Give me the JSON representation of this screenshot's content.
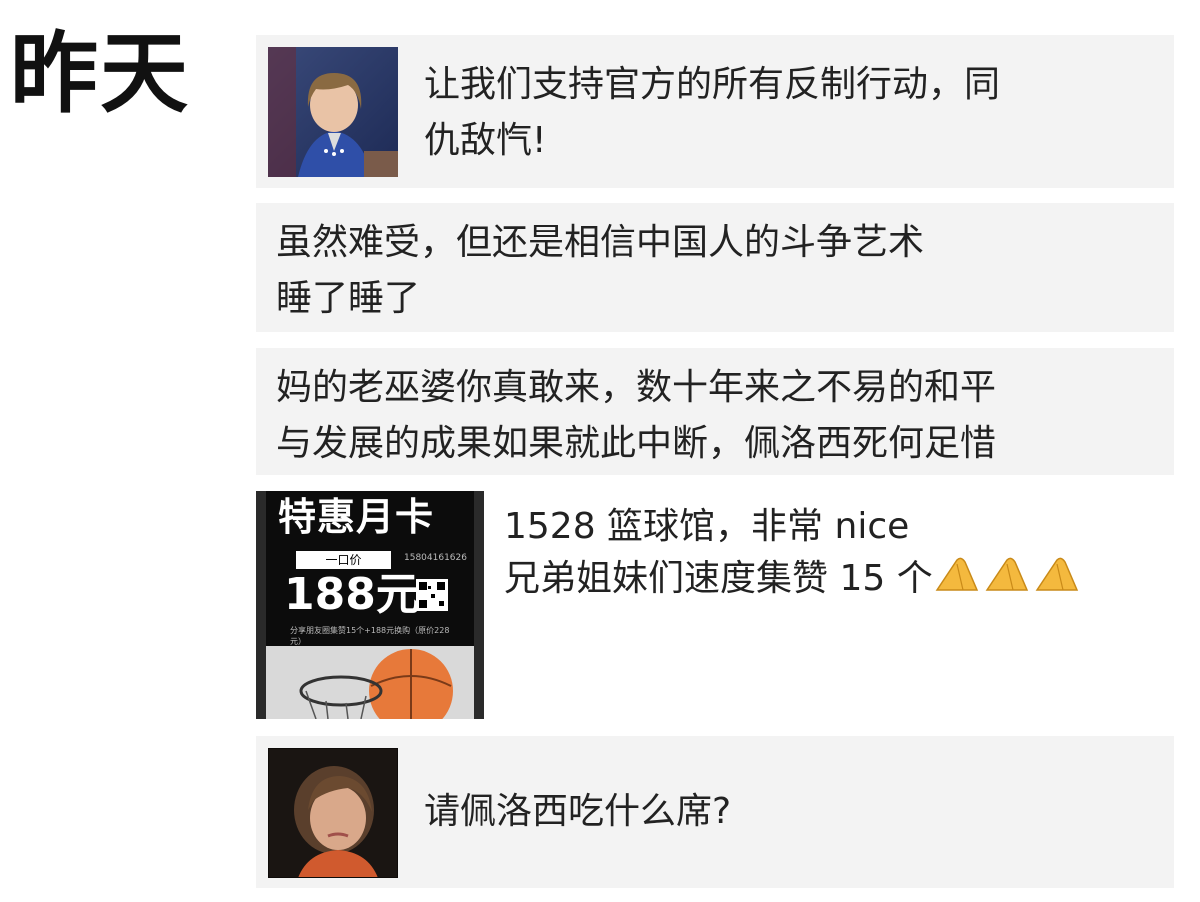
{
  "header": {
    "day_label": "昨天"
  },
  "posts": [
    {
      "text": "让我们支持官方的所有反制行动，同\n仇敌忾!",
      "thumbnail": "portrait-photo"
    },
    {
      "text": "虽然难受，但还是相信中国人的斗争艺术\n睡了睡了"
    },
    {
      "text": "妈的老巫婆你真敢来，数十年来之不易的和平\n与发展的成果如果就此中断，佩洛西死何足惜"
    },
    {
      "text_line1": "1528 篮球馆，非常 nice",
      "text_line2": "兄弟姐妹们速度集赞 15 个",
      "emoji": "folded-hands-icon",
      "poster": {
        "title": "特惠月卡",
        "price_tag": "一口价",
        "price": "188元",
        "phone": "15804161626",
        "caption": "分享朋友圈集赞15个+188元换购（原价228元）"
      }
    },
    {
      "text": "请佩洛西吃什么席?",
      "thumbnail": "portrait-photo"
    }
  ],
  "colors": {
    "card_bg": "#f3f3f3",
    "text": "#222222",
    "emoji_fill": "#f4b93e"
  }
}
